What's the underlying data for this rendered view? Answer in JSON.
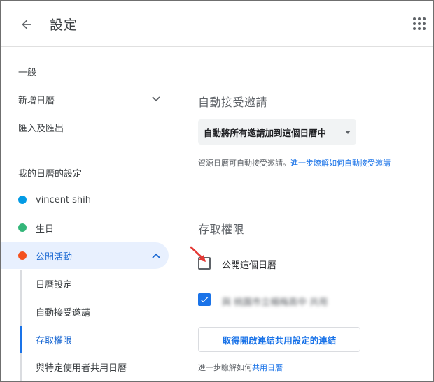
{
  "header": {
    "back_icon": "arrow-left-icon",
    "title": "設定",
    "apps_icon": "grid-apps-icon"
  },
  "sidebar": {
    "items": [
      {
        "label": "一般"
      },
      {
        "label": "新增日曆"
      },
      {
        "label": "匯入及匯出"
      }
    ],
    "my_calendars_header": "我的日曆的設定",
    "calendars": [
      {
        "label": "vincent shih",
        "color": "#039be5"
      },
      {
        "label": "生日",
        "color": "#33b679"
      },
      {
        "label": "公開活動",
        "color": "#f4511e"
      }
    ],
    "sub_items": [
      {
        "label": "日曆設定"
      },
      {
        "label": "自動接受邀請"
      },
      {
        "label": "存取權限"
      },
      {
        "label": "與特定使用者共用日曆"
      }
    ]
  },
  "main": {
    "auto_accept": {
      "title": "自動接受邀請",
      "dropdown_value": "自動將所有邀請加到這個日曆中",
      "help_prefix": "資源日曆可自動接受邀請。",
      "help_link": "進一步瞭解如何自動接受邀請"
    },
    "access": {
      "title": "存取權限",
      "public_label": "公開這個日曆",
      "org_label": "與 桃園市立楊梅高中 共用",
      "link_button": "取得開啟連結共用設定的連結",
      "footer_prefix": "進一步瞭解如何",
      "footer_link": "共用日曆"
    }
  },
  "colors": {
    "accent": "#1a73e8",
    "active_bg": "#e8f0fe",
    "annotation_arrow": "#e53935"
  }
}
